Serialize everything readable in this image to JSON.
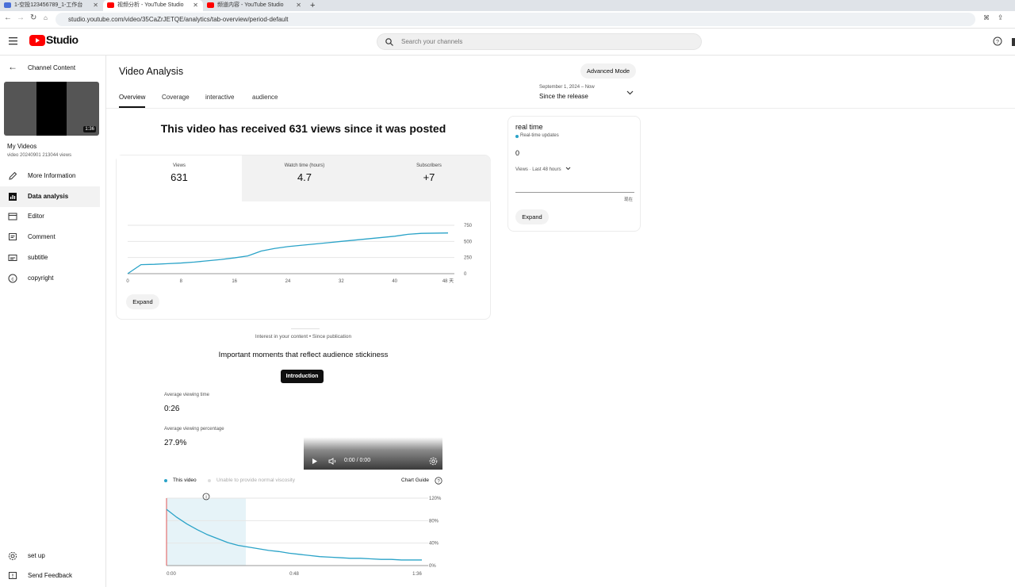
{
  "browser": {
    "tabs": [
      {
        "label": "1-空投123456789_1-工作台",
        "active": false
      },
      {
        "label": "视频分析 - YouTube Studio",
        "active": true
      },
      {
        "label": "频道内容 - YouTube Studio",
        "active": false
      }
    ],
    "url": "studio.youtube.com/video/35CaZrJETQE/analytics/tab-overview/period-default"
  },
  "header": {
    "logo_text": "Studio",
    "search_placeholder": "Search your channels"
  },
  "sidebar": {
    "back_label": "Channel Content",
    "video_duration": "1:36",
    "video_title": "My Videos",
    "video_subtitle": "video 20240901 213044 views",
    "items": [
      {
        "label": "More Information",
        "icon": "pencil-icon"
      },
      {
        "label": "Data analysis",
        "icon": "analytics-icon"
      },
      {
        "label": "Editor",
        "icon": "editor-icon"
      },
      {
        "label": "Comment",
        "icon": "comment-icon"
      },
      {
        "label": "subtitle",
        "icon": "subtitle-icon"
      },
      {
        "label": "copyright",
        "icon": "copyright-icon"
      }
    ],
    "bottom_items": [
      {
        "label": "set up",
        "icon": "gear-icon"
      },
      {
        "label": "Send Feedback",
        "icon": "feedback-icon"
      }
    ]
  },
  "main": {
    "title": "Video Analysis",
    "advanced_mode": "Advanced Mode",
    "tabs": [
      "Overview",
      "Coverage",
      "interactive",
      "audience"
    ],
    "period": {
      "range": "September 1, 2024 – Now",
      "label": "Since the release"
    },
    "headline": "This video has received 631 views since it was posted",
    "metrics": [
      {
        "label": "Views",
        "value": "631"
      },
      {
        "label": "Watch time (hours)",
        "value": "4.7"
      },
      {
        "label": "Subscribers",
        "value": "+7"
      }
    ],
    "expand_label": "Expand",
    "interest_caption": "Interest in your content • Since publication",
    "moments_title": "Important moments that reflect audience stickiness",
    "intro_button": "Introduction",
    "avg_view_time_label": "Average viewing time",
    "avg_view_time": "0:26",
    "avg_view_pct_label": "Average viewing percentage",
    "avg_view_pct": "27.9%",
    "player_time": "0:00 / 0:00",
    "legend_this_video": "This video",
    "legend_other": "Unable to provide normal viscosity",
    "chart_guide": "Chart Guide"
  },
  "realtime": {
    "title": "real time",
    "subtitle": "Real-time updates",
    "count": "0",
    "views_label": "Views · Last 48 hours",
    "now_label": "现在",
    "expand_label": "Expand"
  },
  "colors": {
    "accent": "#2aa3c8",
    "brand_red": "#ff0000"
  },
  "chart_data": [
    {
      "type": "line",
      "x": [
        0,
        2,
        4,
        6,
        8,
        10,
        12,
        14,
        16,
        18,
        20,
        22,
        24,
        26,
        28,
        30,
        32,
        34,
        36,
        38,
        40,
        42,
        44,
        46,
        48
      ],
      "series": [
        {
          "values": [
            0,
            140,
            145,
            155,
            165,
            180,
            200,
            220,
            245,
            275,
            350,
            390,
            420,
            440,
            460,
            480,
            500,
            520,
            540,
            560,
            580,
            610,
            625,
            628,
            631
          ]
        }
      ],
      "xticks": [
        "0",
        "8",
        "16",
        "24",
        "32",
        "40",
        "48 天"
      ],
      "yticks": [
        "0",
        "250",
        "500",
        "750"
      ],
      "ylim": [
        0,
        750
      ]
    },
    {
      "type": "line",
      "x_labels": [
        "0:00",
        "0:48",
        "1:36"
      ],
      "yticks": [
        "0%",
        "40%",
        "80%",
        "120%"
      ],
      "ylim": [
        0,
        120
      ],
      "series": [
        {
          "name": "This video",
          "values": [
            100,
            86,
            74,
            64,
            55,
            48,
            41,
            36,
            33,
            30,
            27,
            25,
            22,
            20,
            18,
            16,
            15,
            14,
            13,
            13,
            12,
            11,
            11,
            10,
            10,
            10
          ]
        }
      ]
    }
  ]
}
